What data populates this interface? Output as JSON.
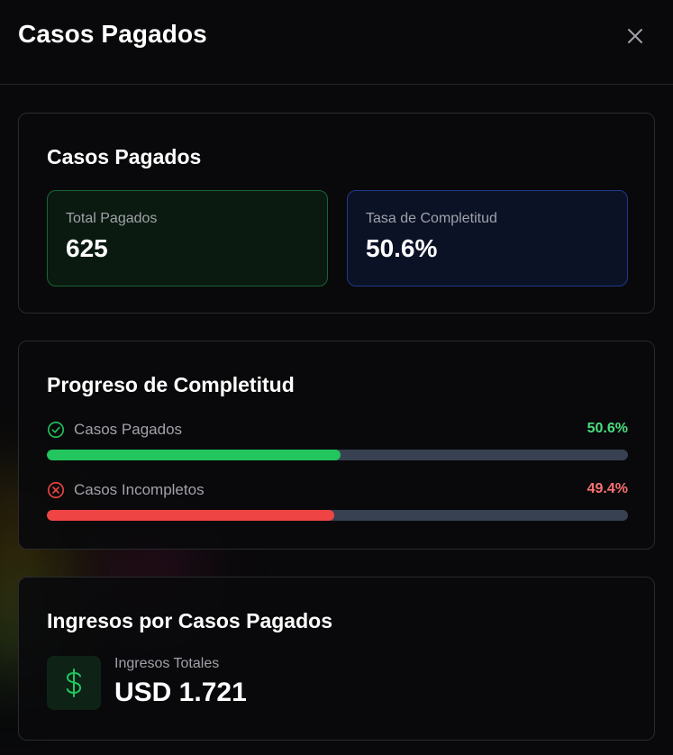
{
  "modal": {
    "title": "Casos Pagados",
    "close_icon": "close-icon"
  },
  "summary": {
    "title": "Casos Pagados",
    "total": {
      "label": "Total Pagados",
      "value": "625"
    },
    "rate": {
      "label": "Tasa de Completitud",
      "value": "50.6%"
    }
  },
  "progress": {
    "title": "Progreso de Completitud",
    "items": [
      {
        "label": "Casos Pagados",
        "pct_text": "50.6%",
        "fraction": 0.506,
        "icon": "check-circle-icon",
        "color": "#22c55e",
        "text_color": "#4ade80"
      },
      {
        "label": "Casos Incompletos",
        "pct_text": "49.4%",
        "fraction": 0.494,
        "icon": "x-circle-icon",
        "color": "#ef4444",
        "text_color": "#f87171"
      }
    ],
    "track_color": "#374151"
  },
  "income": {
    "title": "Ingresos por Casos Pagados",
    "label": "Ingresos Totales",
    "value": "USD 1.721",
    "icon": "dollar-icon"
  },
  "colors": {
    "background": "#09090b",
    "accent_green": "#22c55e",
    "accent_red": "#ef4444",
    "muted_text": "#a1a1aa"
  }
}
